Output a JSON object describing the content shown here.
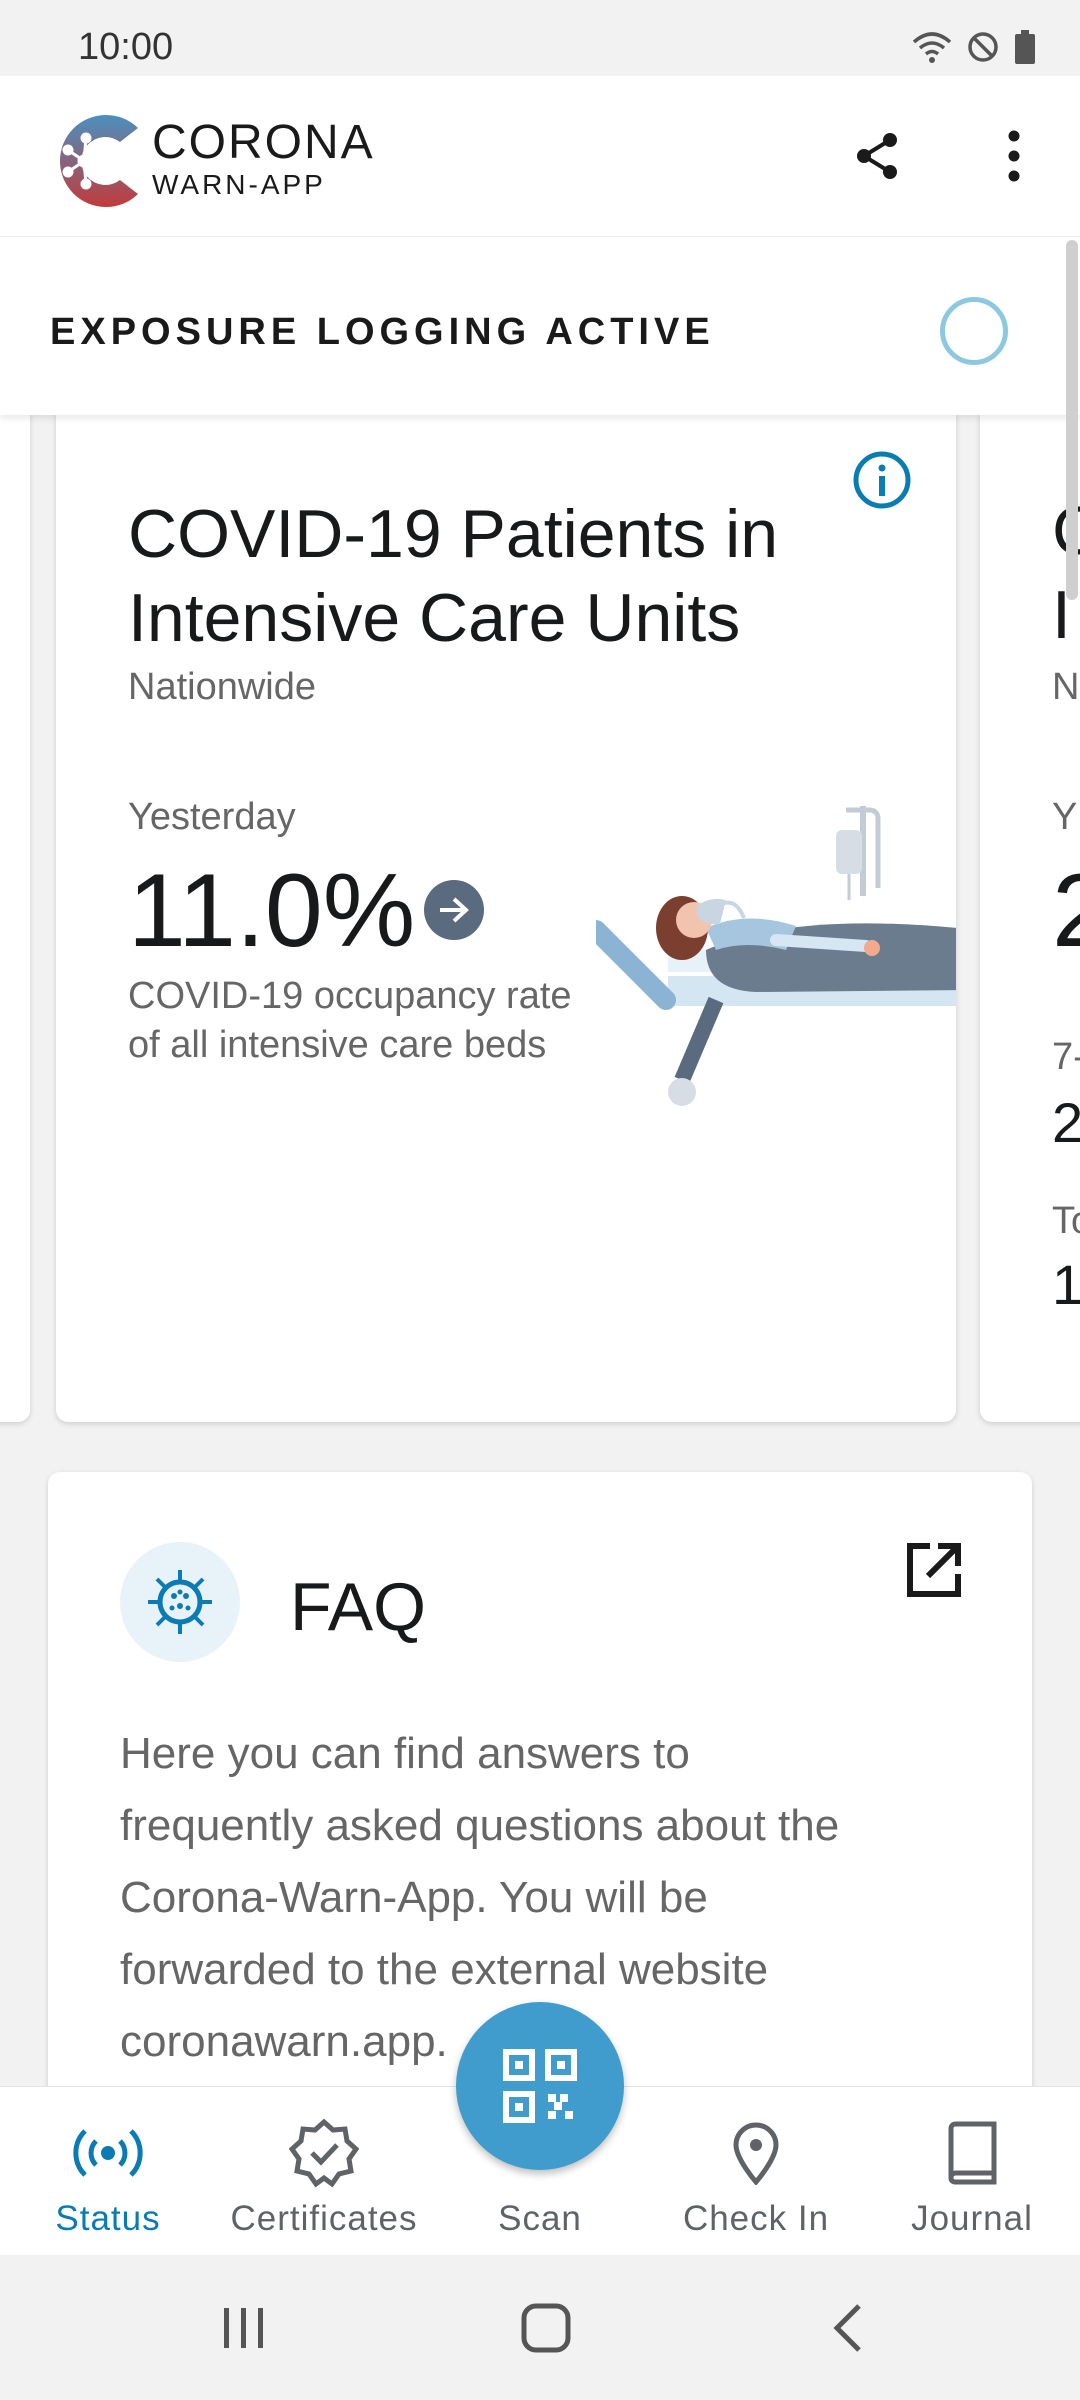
{
  "status_bar": {
    "time": "10:00"
  },
  "app": {
    "logo_line1": "CORONA",
    "logo_line2": "WARN-APP"
  },
  "tracing": {
    "label": "EXPOSURE LOGGING ACTIVE"
  },
  "stat_card": {
    "title": "COVID-19 Patients in Intensive Care Units",
    "region": "Nationwide",
    "period": "Yesterday",
    "value": "11.0%",
    "trend": "increasing",
    "description": "COVID-19 occupancy rate of all intensive care beds"
  },
  "next_card_peek": {
    "line1": "C",
    "line2": "I",
    "line3": "N",
    "line4": "Y",
    "big": "2",
    "line5": "7-",
    "line6": "2",
    "line7": "To",
    "line8": "1"
  },
  "faq": {
    "title": "FAQ",
    "text": "Here you can find answers to frequently asked questions about the Corona-Warn-App. You will be forwarded to the external website coronawarn.app."
  },
  "bottom_nav": {
    "items": [
      {
        "label": "Status",
        "icon": "broadcast-icon",
        "active": true
      },
      {
        "label": "Certificates",
        "icon": "certificate-badge-icon"
      },
      {
        "label": "Scan",
        "icon": "qr-code-icon"
      },
      {
        "label": "Check In",
        "icon": "location-pin-icon"
      },
      {
        "label": "Journal",
        "icon": "book-icon"
      }
    ]
  },
  "colors": {
    "accent": "#0b7cb3",
    "fab": "#3f9ccc",
    "tracing_ring": "#8cc8df",
    "logo_red": "#c23a3a",
    "logo_blue": "#4a90c0"
  }
}
